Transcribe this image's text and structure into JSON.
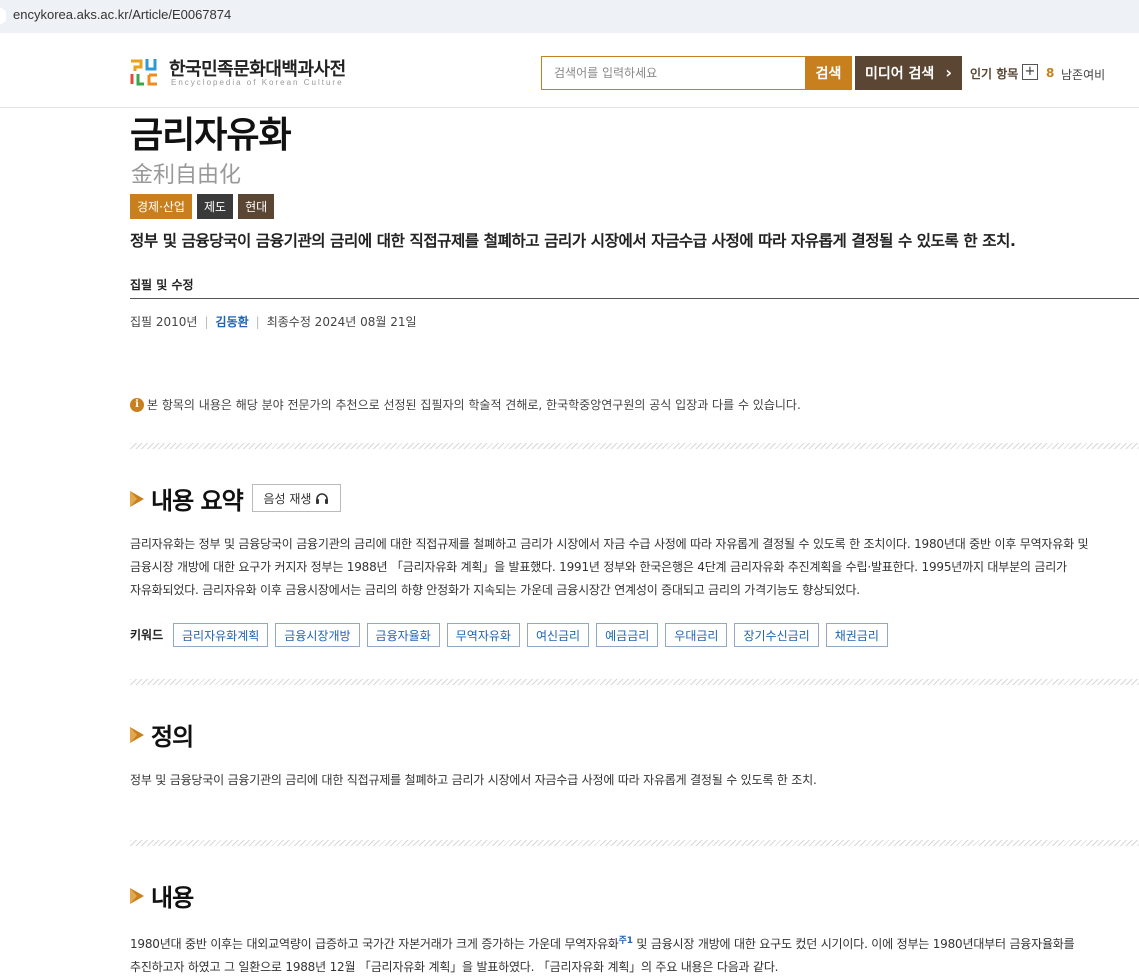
{
  "browser": {
    "url": "encykorea.aks.ac.kr/Article/E0067874"
  },
  "header": {
    "logo_title": "한국민족문화대백과사전",
    "logo_subtitle": "Encyclopedia of Korean Culture",
    "search_placeholder": "검색어를 입력하세요",
    "search_button": "검색",
    "media_search_button": "미디어 검색",
    "popular_label": "인기 항목",
    "popular_rank": "8",
    "popular_word": "남존여비"
  },
  "article": {
    "title": "금리자유화",
    "hanja": "金利自由化",
    "tags": [
      "경제·산업",
      "제도",
      "현대"
    ],
    "lead": "정부 및 금융당국이 금융기관의 금리에 대한 직접규제를 철폐하고 금리가 시장에서 자금수급 사정에 따라 자유롭게 결정될 수 있도록 한 조치.",
    "edit_heading": "집필 및 수정",
    "written": "집필 2010년",
    "author": "김동환",
    "modified": "최종수정 2024년 08월 21일",
    "notice": "본 항목의 내용은 해당 분야 전문가의 추천으로 선정된 집필자의 학술적 견해로, 한국학중앙연구원의 공식 입장과 다를 수 있습니다."
  },
  "summary": {
    "heading": "내용 요약",
    "audio_button": "음성 재생",
    "lines": [
      "금리자유화는 정부 및 금융당국이 금융기관의 금리에 대한 직접규제를 철폐하고 금리가 시장에서 자금 수급 사정에 따라 자유롭게 결정될 수 있도록 한 조치이다. 1980년대 중반 이후 무역자유화 및",
      "금융시장 개방에 대한 요구가 커지자 정부는 1988년 「금리자유화 계획」을 발표했다. 1991년 정부와 한국은행은 4단계 금리자유화 추진계획을 수립·발표한다. 1995년까지 대부분의 금리가",
      "자유화되었다. 금리자유화 이후 금융시장에서는 금리의 하향 안정화가 지속되는 가운데 금융시장간 연계성이 증대되고 금리의 가격기능도 향상되었다."
    ],
    "keyword_label": "키워드",
    "keywords": [
      "금리자유화계획",
      "금융시장개방",
      "금융자율화",
      "무역자유화",
      "여신금리",
      "예금금리",
      "우대금리",
      "장기수신금리",
      "채권금리"
    ]
  },
  "definition": {
    "heading": "정의",
    "text": "정부 및 금융당국이 금융기관의 금리에 대한 직접규제를 철폐하고 금리가 시장에서 자금수급 사정에 따라 자유롭게 결정될 수 있도록 한 조치."
  },
  "content": {
    "heading": "내용",
    "line1_a": "1980년대 중반 이후는 대외교역량이 급증하고 국가간 자본거래가 크게 증가하는 가운데 무역자유화",
    "line1_note": "주1",
    "line1_b": " 및 금융시장 개방에 대한 요구도 컸던 시기이다. 이에 정부는 1980년대부터 금융자율화를",
    "line2": "추진하고자 하였고 그 일환으로 1988년 12월 「금리자유화 계획」을 발표하였다. 「금리자유화 계획」의 주요 내용은 다음과 같다."
  },
  "colors": {
    "accent": "#c8801f",
    "brown": "#5b4633",
    "link": "#1f63b5"
  }
}
